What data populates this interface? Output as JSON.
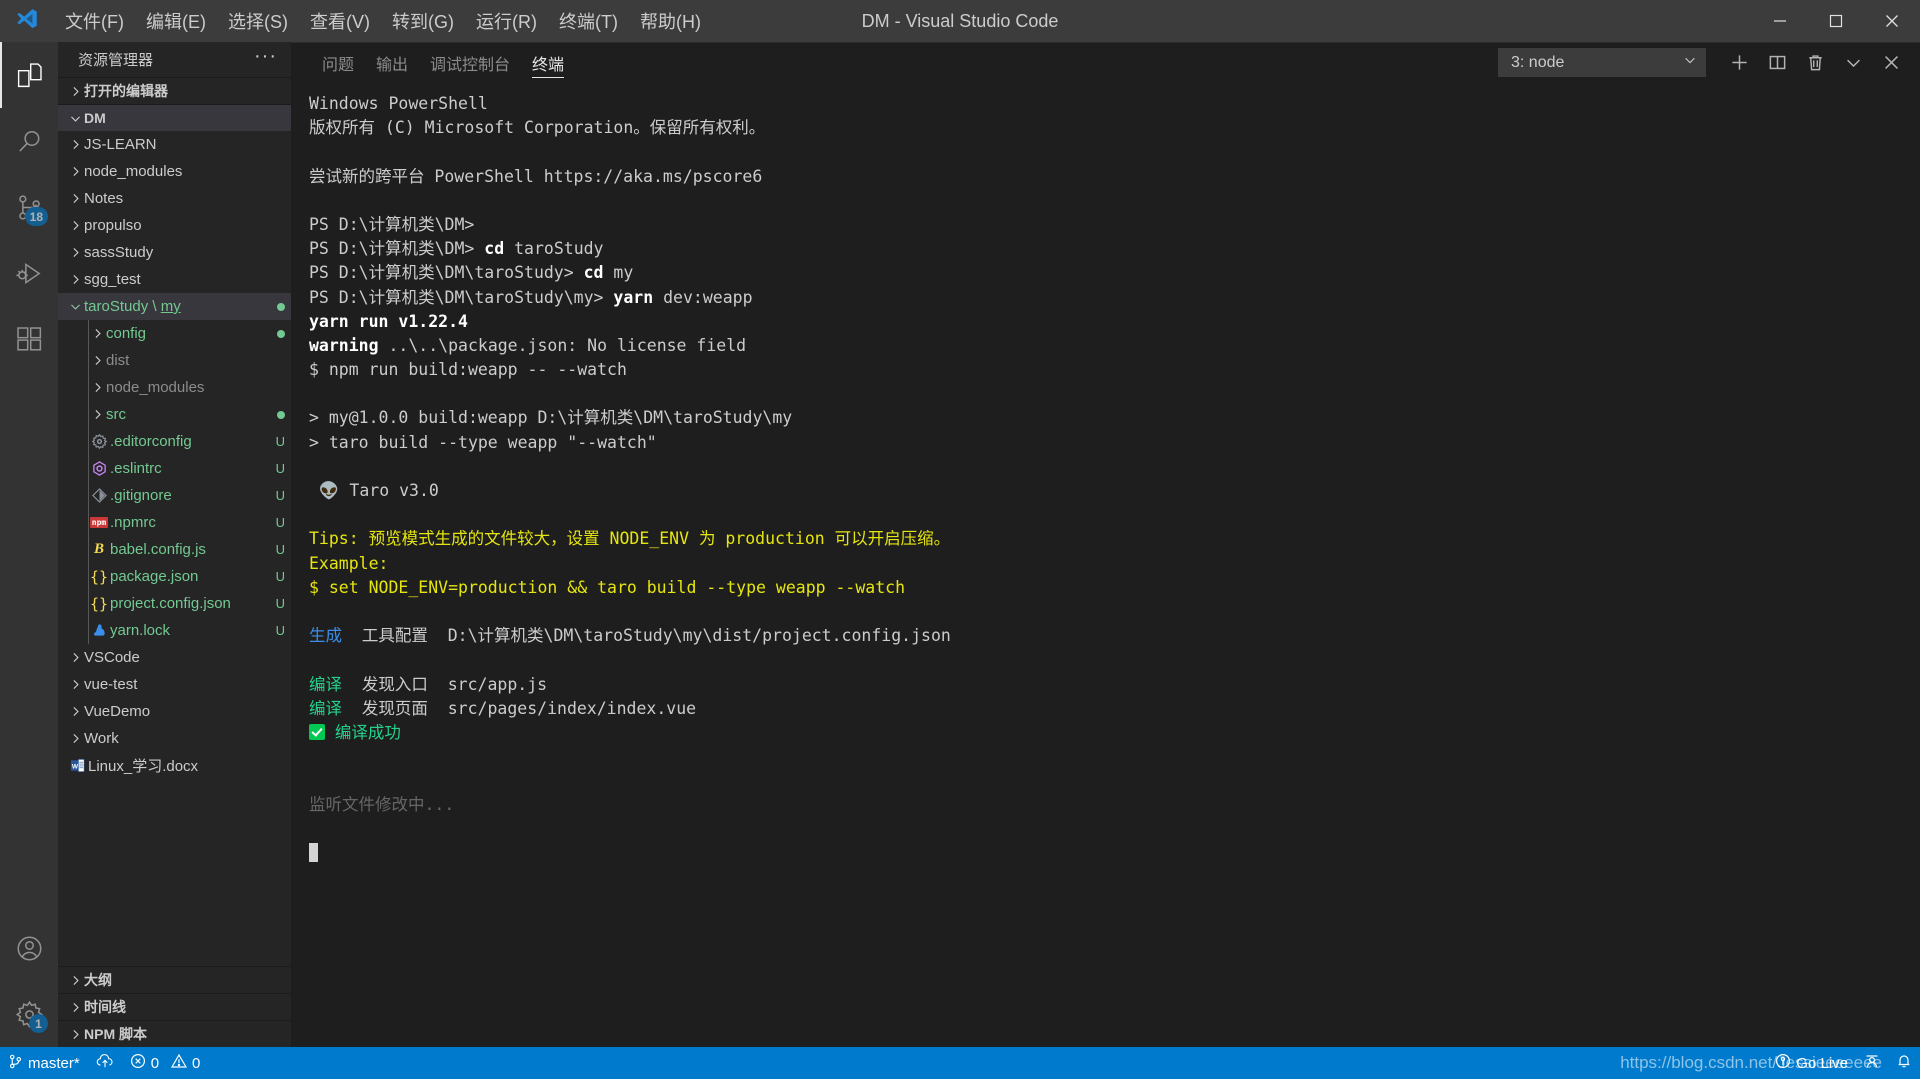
{
  "titlebar": {
    "window_title": "DM - Visual Studio Code",
    "logo_icon": "vscode-logo-icon",
    "menus": [
      {
        "label": "文件(F)",
        "name": "menu-file"
      },
      {
        "label": "编辑(E)",
        "name": "menu-edit"
      },
      {
        "label": "选择(S)",
        "name": "menu-selection"
      },
      {
        "label": "查看(V)",
        "name": "menu-view"
      },
      {
        "label": "转到(G)",
        "name": "menu-go"
      },
      {
        "label": "运行(R)",
        "name": "menu-run"
      },
      {
        "label": "终端(T)",
        "name": "menu-terminal"
      },
      {
        "label": "帮助(H)",
        "name": "menu-help"
      }
    ],
    "window_controls": [
      "minimize-icon",
      "maximize-icon",
      "close-icon"
    ]
  },
  "activitybar": {
    "items": [
      {
        "name": "activity-explorer",
        "icon": "files-icon",
        "active": true,
        "badge": ""
      },
      {
        "name": "activity-search",
        "icon": "search-icon",
        "active": false,
        "badge": ""
      },
      {
        "name": "activity-source-control",
        "icon": "source-control-icon",
        "active": false,
        "badge": "18"
      },
      {
        "name": "activity-run-debug",
        "icon": "run-debug-icon",
        "active": false,
        "badge": ""
      },
      {
        "name": "activity-extensions",
        "icon": "extensions-icon",
        "active": false,
        "badge": ""
      }
    ],
    "bottom_items": [
      {
        "name": "activity-accounts",
        "icon": "account-icon",
        "badge": ""
      },
      {
        "name": "activity-settings",
        "icon": "gear-icon",
        "badge": "1"
      }
    ]
  },
  "sidebar": {
    "title": "资源管理器",
    "more_actions": "···",
    "sections": [
      {
        "label": "打开的编辑器",
        "name": "section-open-editors",
        "expanded": false,
        "selected": false
      },
      {
        "label": "DM",
        "name": "section-dm",
        "expanded": true,
        "selected": true
      }
    ],
    "tree": [
      {
        "name": "JS-LEARN",
        "indent": 1,
        "type": "folder",
        "expanded": false,
        "color": "white",
        "git": ""
      },
      {
        "name": "node_modules",
        "indent": 1,
        "type": "folder",
        "expanded": false,
        "color": "white",
        "git": ""
      },
      {
        "name": "Notes",
        "indent": 1,
        "type": "folder",
        "expanded": false,
        "color": "white",
        "git": ""
      },
      {
        "name": "propulso",
        "indent": 1,
        "type": "folder",
        "expanded": false,
        "color": "white",
        "git": ""
      },
      {
        "name": "sassStudy",
        "indent": 1,
        "type": "folder",
        "expanded": false,
        "color": "white",
        "git": ""
      },
      {
        "name": "sgg_test",
        "indent": 1,
        "type": "folder",
        "expanded": false,
        "color": "white",
        "git": ""
      },
      {
        "name": "taroStudy \\ my",
        "indent": 1,
        "type": "folder",
        "expanded": true,
        "color": "green",
        "git": "",
        "selected": true,
        "dot": true,
        "underline_tail": "my"
      },
      {
        "name": "config",
        "indent": 2,
        "type": "folder",
        "expanded": false,
        "color": "green",
        "git": "",
        "dot": true
      },
      {
        "name": "dist",
        "indent": 2,
        "type": "folder",
        "expanded": false,
        "color": "dim",
        "git": ""
      },
      {
        "name": "node_modules",
        "indent": 2,
        "type": "folder",
        "expanded": false,
        "color": "dim",
        "git": ""
      },
      {
        "name": "src",
        "indent": 2,
        "type": "folder",
        "expanded": false,
        "color": "green",
        "git": "",
        "dot": true
      },
      {
        "name": ".editorconfig",
        "indent": 2,
        "type": "file",
        "icon": "gear-file-icon",
        "color": "green",
        "git": "U"
      },
      {
        "name": ".eslintrc",
        "indent": 2,
        "type": "file",
        "icon": "eslint-icon",
        "color": "green",
        "git": "U"
      },
      {
        "name": ".gitignore",
        "indent": 2,
        "type": "file",
        "icon": "git-icon",
        "color": "green",
        "git": "U"
      },
      {
        "name": ".npmrc",
        "indent": 2,
        "type": "file",
        "icon": "npm-icon",
        "color": "green",
        "git": "U"
      },
      {
        "name": "babel.config.js",
        "indent": 2,
        "type": "file",
        "icon": "babel-icon",
        "color": "green",
        "git": "U"
      },
      {
        "name": "package.json",
        "indent": 2,
        "type": "file",
        "icon": "json-icon",
        "color": "green",
        "git": "U"
      },
      {
        "name": "project.config.json",
        "indent": 2,
        "type": "file",
        "icon": "json-icon",
        "color": "green",
        "git": "U"
      },
      {
        "name": "yarn.lock",
        "indent": 2,
        "type": "file",
        "icon": "yarn-icon",
        "color": "green",
        "git": "U"
      },
      {
        "name": "VSCode",
        "indent": 1,
        "type": "folder",
        "expanded": false,
        "color": "white",
        "git": ""
      },
      {
        "name": "vue-test",
        "indent": 1,
        "type": "folder",
        "expanded": false,
        "color": "white",
        "git": ""
      },
      {
        "name": "VueDemo",
        "indent": 1,
        "type": "folder",
        "expanded": false,
        "color": "white",
        "git": ""
      },
      {
        "name": "Work",
        "indent": 1,
        "type": "folder",
        "expanded": false,
        "color": "white",
        "git": ""
      },
      {
        "name": "Linux_学习.docx",
        "indent": 1,
        "type": "file",
        "icon": "word-icon",
        "color": "white",
        "git": ""
      }
    ],
    "bottom_sections": [
      {
        "label": "大纲",
        "name": "section-outline"
      },
      {
        "label": "时间线",
        "name": "section-timeline"
      },
      {
        "label": "NPM 脚本",
        "name": "section-npm-scripts"
      }
    ]
  },
  "panel": {
    "tabs": [
      {
        "label": "问题",
        "name": "tab-problems",
        "active": false
      },
      {
        "label": "输出",
        "name": "tab-output",
        "active": false
      },
      {
        "label": "调试控制台",
        "name": "tab-debug-console",
        "active": false
      },
      {
        "label": "终端",
        "name": "tab-terminal",
        "active": true
      }
    ],
    "terminal_selector": "3: node",
    "actions": [
      {
        "name": "new-terminal-button",
        "icon": "plus-icon"
      },
      {
        "name": "split-terminal-button",
        "icon": "split-icon"
      },
      {
        "name": "kill-terminal-button",
        "icon": "trash-icon"
      },
      {
        "name": "panel-maximize-button",
        "icon": "chevron-down-icon"
      },
      {
        "name": "close-panel-button",
        "icon": "close-icon"
      }
    ]
  },
  "terminal": {
    "lines": [
      [
        {
          "t": "Windows PowerShell",
          "c": "c-grey"
        }
      ],
      [
        {
          "t": "版权所有 (C) Microsoft Corporation。保留所有权利。",
          "c": "c-grey"
        }
      ],
      [
        {
          "t": "",
          "c": "c-grey"
        }
      ],
      [
        {
          "t": "尝试新的跨平台 PowerShell https://aka.ms/pscore6",
          "c": "c-grey"
        }
      ],
      [
        {
          "t": "",
          "c": "c-grey"
        }
      ],
      [
        {
          "t": "PS D:\\计算机类\\DM>",
          "c": "c-grey"
        }
      ],
      [
        {
          "t": "PS D:\\计算机类\\DM> ",
          "c": "c-grey"
        },
        {
          "t": "cd",
          "c": "c-yellow c-bold"
        },
        {
          "t": " taroStudy",
          "c": "c-grey"
        }
      ],
      [
        {
          "t": "PS D:\\计算机类\\DM\\taroStudy> ",
          "c": "c-grey"
        },
        {
          "t": "cd",
          "c": "c-yellow c-bold"
        },
        {
          "t": " my",
          "c": "c-grey"
        }
      ],
      [
        {
          "t": "PS D:\\计算机类\\DM\\taroStudy\\my> ",
          "c": "c-grey"
        },
        {
          "t": "yarn",
          "c": "c-yellow c-bold"
        },
        {
          "t": " dev:weapp",
          "c": "c-grey"
        }
      ],
      [
        {
          "t": "yarn run v1.22.4",
          "c": "c-bold"
        }
      ],
      [
        {
          "t": "warning",
          "c": "c-yellow c-bold"
        },
        {
          "t": " ..\\..\\package.json: No license field",
          "c": "c-grey"
        }
      ],
      [
        {
          "t": "$ npm run build:weapp -- --watch",
          "c": "c-grey"
        }
      ],
      [
        {
          "t": "",
          "c": "c-grey"
        }
      ],
      [
        {
          "t": "> my@1.0.0 build:weapp D:\\计算机类\\DM\\taroStudy\\my",
          "c": "c-grey"
        }
      ],
      [
        {
          "t": "> taro build --type weapp \"--watch\"",
          "c": "c-grey"
        }
      ],
      [
        {
          "t": "",
          "c": "c-grey"
        }
      ],
      [
        {
          "t": " 👽 Taro v3.0",
          "c": "c-grey"
        }
      ],
      [
        {
          "t": "",
          "c": "c-grey"
        }
      ],
      [
        {
          "t": "Tips: 预览模式生成的文件较大，设置 NODE_ENV 为 production 可以开启压缩。",
          "c": "c-yellow"
        }
      ],
      [
        {
          "t": "Example:",
          "c": "c-yellow"
        }
      ],
      [
        {
          "t": "$ set NODE_ENV=production && taro build --type weapp --watch",
          "c": "c-yellow"
        }
      ],
      [
        {
          "t": "",
          "c": "c-grey"
        }
      ],
      [
        {
          "t": "生成",
          "c": "c-blue"
        },
        {
          "t": "  工具配置  D:\\计算机类\\DM\\taroStudy\\my\\dist/project.config.json",
          "c": "c-grey"
        }
      ],
      [
        {
          "t": "",
          "c": "c-grey"
        }
      ],
      [
        {
          "t": "编译",
          "c": "c-green"
        },
        {
          "t": "  发现入口  src/app.js",
          "c": "c-grey"
        }
      ],
      [
        {
          "t": "编译",
          "c": "c-green"
        },
        {
          "t": "  发现页面  src/pages/index/index.vue",
          "c": "c-grey"
        }
      ],
      [
        {
          "t": "__CHECK__",
          "c": "c-green"
        },
        {
          "t": " 编译成功",
          "c": "c-green"
        }
      ],
      [
        {
          "t": "",
          "c": "c-grey"
        }
      ],
      [
        {
          "t": "",
          "c": "c-grey"
        }
      ],
      [
        {
          "t": "监听文件修改中...",
          "c": "c-dim"
        }
      ],
      [
        {
          "t": "",
          "c": "c-grey"
        }
      ],
      [
        {
          "t": "__CURSOR__",
          "c": "c-grey"
        }
      ]
    ]
  },
  "statusbar": {
    "branch": "master*",
    "branch_icon": "source-control-branch-icon",
    "sync_icon": "sync-cloud-icon",
    "errors": "0",
    "warnings": "0",
    "error_icon": "error-circle-icon",
    "warning_icon": "warning-triangle-icon",
    "go_live": "Go Live",
    "go_live_icon": "broadcast-icon",
    "feedback_icon": "smiley-icon",
    "bell_icon": "bell-icon",
    "watermark": "https://blog.csdn.net/Jessieeeeeee"
  },
  "colors": {
    "accent": "#007acc",
    "titlebar_bg": "#3c3c3c",
    "sidebar_bg": "#252526",
    "editor_bg": "#1e1e1e",
    "activitybar_bg": "#333333",
    "git_untracked": "#73c991",
    "terminal_yellow": "#e5e510",
    "terminal_green": "#23d18b",
    "terminal_blue": "#3b8eea"
  }
}
